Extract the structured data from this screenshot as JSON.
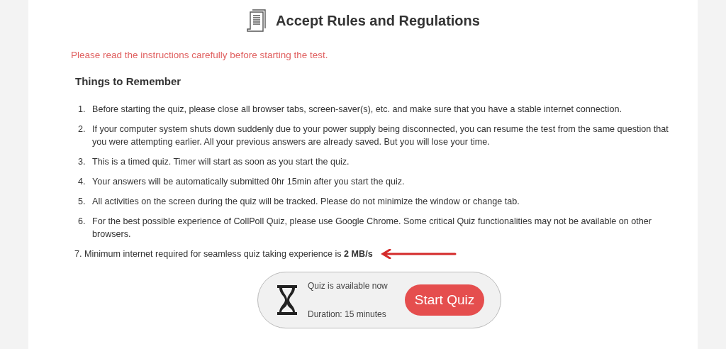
{
  "title": "Accept Rules and Regulations",
  "notice": "Please read the instructions carefully before starting the test.",
  "section_heading": "Things to Remember",
  "rules": [
    {
      "kind": "numbered",
      "number": "1.",
      "text": "Before starting the quiz, please close all browser tabs, screen-saver(s), etc. and make sure that you have a stable internet connection."
    },
    {
      "kind": "numbered",
      "number": "2.",
      "text": "If your computer system shuts down suddenly due to your power supply being disconnected, you can resume the test from the same question that you were attempting earlier. All your previous answers are already saved. But you will lose your time."
    },
    {
      "kind": "numbered",
      "number": "3.",
      "text": "This is a timed quiz. Timer will start as soon as you start the quiz."
    },
    {
      "kind": "numbered",
      "number": "4.",
      "text": "Your answers will be automatically submitted 0hr 15min after you start the quiz."
    },
    {
      "kind": "numbered",
      "number": "5.",
      "text": "All activities on the screen during the quiz will be tracked. Please do not minimize the window or change tab."
    },
    {
      "kind": "numbered",
      "number": "6.",
      "text": "For the best possible experience of CollPoll Quiz, please use Google Chrome. Some critical Quiz functionalities may not be available on other browsers."
    },
    {
      "kind": "highlighted",
      "text": "7. Minimum internet required for seamless quiz taking experience is **2 MB/s**"
    }
  ],
  "quiz_card": {
    "status": "Quiz is available now",
    "duration": "Duration: 15 minutes",
    "button": "Start Quiz"
  }
}
